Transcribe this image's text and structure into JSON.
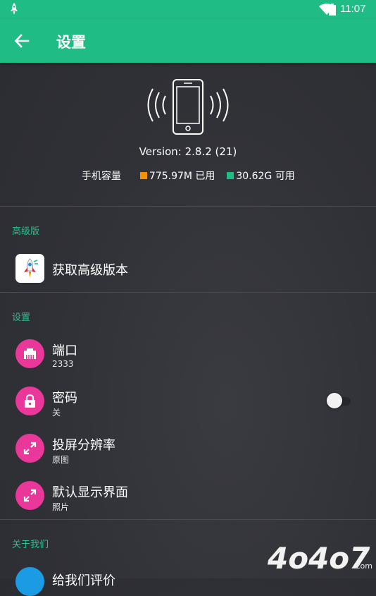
{
  "status_bar": {
    "time": "11:07",
    "icons": [
      "rocket-icon",
      "wifi-icon",
      "battery-icon"
    ]
  },
  "app_bar": {
    "title": "设置",
    "back_icon": "arrow-left-icon"
  },
  "device": {
    "icon": "phone-vibrate-icon",
    "version": "Version: 2.8.2 (21)",
    "storage_label": "手机容量",
    "used": "775.97M 已用",
    "free": "30.62G 可用",
    "used_color": "#f39200",
    "free_color": "#1fbc85"
  },
  "premium": {
    "header": "高级版",
    "item": {
      "label": "获取高级版本",
      "icon": "rocket-app-icon"
    }
  },
  "settings": {
    "header": "设置",
    "items": [
      {
        "label": "端口",
        "sub": "2333",
        "icon": "ethernet-port-icon"
      },
      {
        "label": "密码",
        "sub": "关",
        "icon": "lock-icon",
        "toggle": false
      },
      {
        "label": "投屏分辨率",
        "sub": "原图",
        "icon": "expand-icon"
      },
      {
        "label": "默认显示界面",
        "sub": "照片",
        "icon": "expand-icon"
      }
    ]
  },
  "about": {
    "header": "关于我们",
    "item": {
      "label": "给我们评价",
      "icon": "rate-icon"
    }
  },
  "watermark": {
    "text": "4o4o7",
    "suffix": ".com"
  },
  "colors": {
    "accent": "#1fbc85",
    "icon_bg": "#e9379a",
    "section_header": "#28c08d"
  }
}
